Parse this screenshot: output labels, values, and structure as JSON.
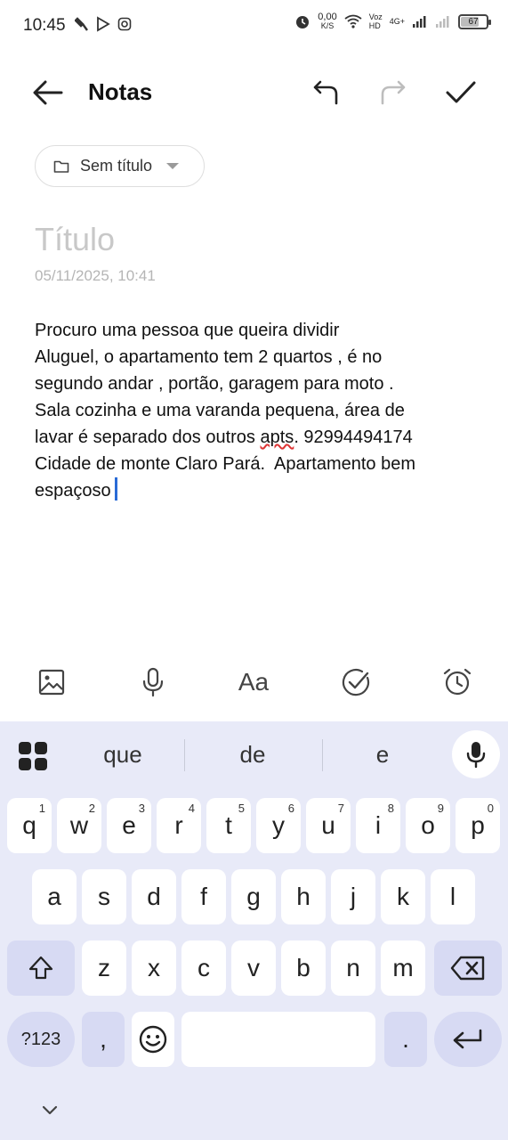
{
  "status_bar": {
    "time": "10:45",
    "speed_value": "0,00",
    "speed_unit": "K/S",
    "voz": "Voz",
    "hd": "HD",
    "network": "4G+",
    "battery": "67",
    "icons": [
      "tool-icon",
      "play-store-icon",
      "instagram-icon",
      "alarm-icon",
      "wifi-icon",
      "signal-icon"
    ]
  },
  "app_bar": {
    "title": "Notas",
    "icons": [
      "back-arrow-icon",
      "undo-icon",
      "redo-icon",
      "check-icon"
    ]
  },
  "folder": {
    "label": "Sem título"
  },
  "note": {
    "title_placeholder": "Título",
    "date": "05/11/2025, 10:41",
    "body_part1": "Procuro uma pessoa que queira dividir\nAluguel, o apartamento tem 2 quartos , é no\nsegundo andar , portão, garagem para moto .\nSala cozinha e uma varanda pequena, área de\nlavar é separado dos outros ",
    "body_misspelled": "apts",
    "body_part2": ". 92994494174\nCidade de monte Claro Pará.  Apartamento bem\nespaçoso"
  },
  "editor_toolbar": {
    "format_label": "Aa",
    "icons": [
      "image-icon",
      "microphone-icon",
      "text-format-icon",
      "checklist-icon",
      "alarm-icon"
    ]
  },
  "keyboard": {
    "suggestions": [
      "que",
      "de",
      "e"
    ],
    "row1": [
      {
        "key": "q",
        "hint": "1"
      },
      {
        "key": "w",
        "hint": "2"
      },
      {
        "key": "e",
        "hint": "3"
      },
      {
        "key": "r",
        "hint": "4"
      },
      {
        "key": "t",
        "hint": "5"
      },
      {
        "key": "y",
        "hint": "6"
      },
      {
        "key": "u",
        "hint": "7"
      },
      {
        "key": "i",
        "hint": "8"
      },
      {
        "key": "o",
        "hint": "9"
      },
      {
        "key": "p",
        "hint": "0"
      }
    ],
    "row2": [
      "a",
      "s",
      "d",
      "f",
      "g",
      "h",
      "j",
      "k",
      "l"
    ],
    "row3": [
      "z",
      "x",
      "c",
      "v",
      "b",
      "n",
      "m"
    ],
    "symbols_label": "?123",
    "comma": ",",
    "period": ".",
    "accent_color": "#d7daf3",
    "background_color": "#e8eaf8"
  }
}
